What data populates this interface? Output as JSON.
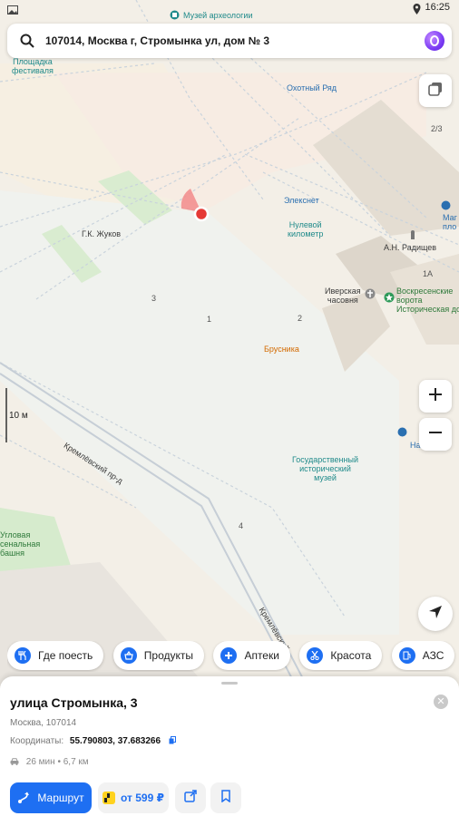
{
  "status": {
    "time": "16:25"
  },
  "search": {
    "query": "107014, Москва г, Стромынка ул, дом № 3"
  },
  "map": {
    "labels": {
      "museum_archaeology": "Музей археологии",
      "festival_square_1": "Площадка",
      "festival_square_2": "фестиваля",
      "okhotny_ryad": "Охотный Ряд",
      "floor": "2/3",
      "eleksnet": "Элекснет",
      "zero_km_1": "Нулевой",
      "zero_km_2": "километр",
      "radishchev": "А.Н. Радищев",
      "magnit_1": "Маг",
      "magnit_2": "пло",
      "house_1a": "1А",
      "zhukov": "Г.К. Жуков",
      "iverskaya_1": "Иверская",
      "iverskaya_2": "часовня",
      "voskr_1": "Воскресенские",
      "voskr_2": "ворота",
      "voskr_3": "Историческая дос",
      "num_3": "3",
      "num_1": "1",
      "num_2": "2",
      "num_4": "4",
      "brusnika": "Брусника",
      "scale": "10 м",
      "nasledie": "Наследие",
      "hist_museum_1": "Государственный",
      "hist_museum_2": "исторический",
      "hist_museum_3": "музей",
      "kremlevsky_1": "Кремлёвский пр-д",
      "kremlevsky_2": "Кремлёвский",
      "arsenal_1": "Угловая",
      "arsenal_2": "сенальная",
      "arsenal_3": "башня"
    }
  },
  "chips": [
    {
      "label": "Где поесть",
      "icon": "fork-knife-icon"
    },
    {
      "label": "Продукты",
      "icon": "basket-icon"
    },
    {
      "label": "Аптеки",
      "icon": "plus-icon"
    },
    {
      "label": "Красота",
      "icon": "scissors-icon"
    },
    {
      "label": "АЗС",
      "icon": "fuel-icon"
    }
  ],
  "sheet": {
    "title": "улица Стромынка, 3",
    "address": "Москва, 107014",
    "coords_label": "Координаты:",
    "coords_value": "55.790803, 37.683266",
    "eta": "26 мин • 6,7 км",
    "route_label": "Маршрут",
    "taxi_label": "от 599 ₽"
  },
  "colors": {
    "accent": "#1e6ff2",
    "alice": "#7b3cf5",
    "marker": "#e53935"
  }
}
